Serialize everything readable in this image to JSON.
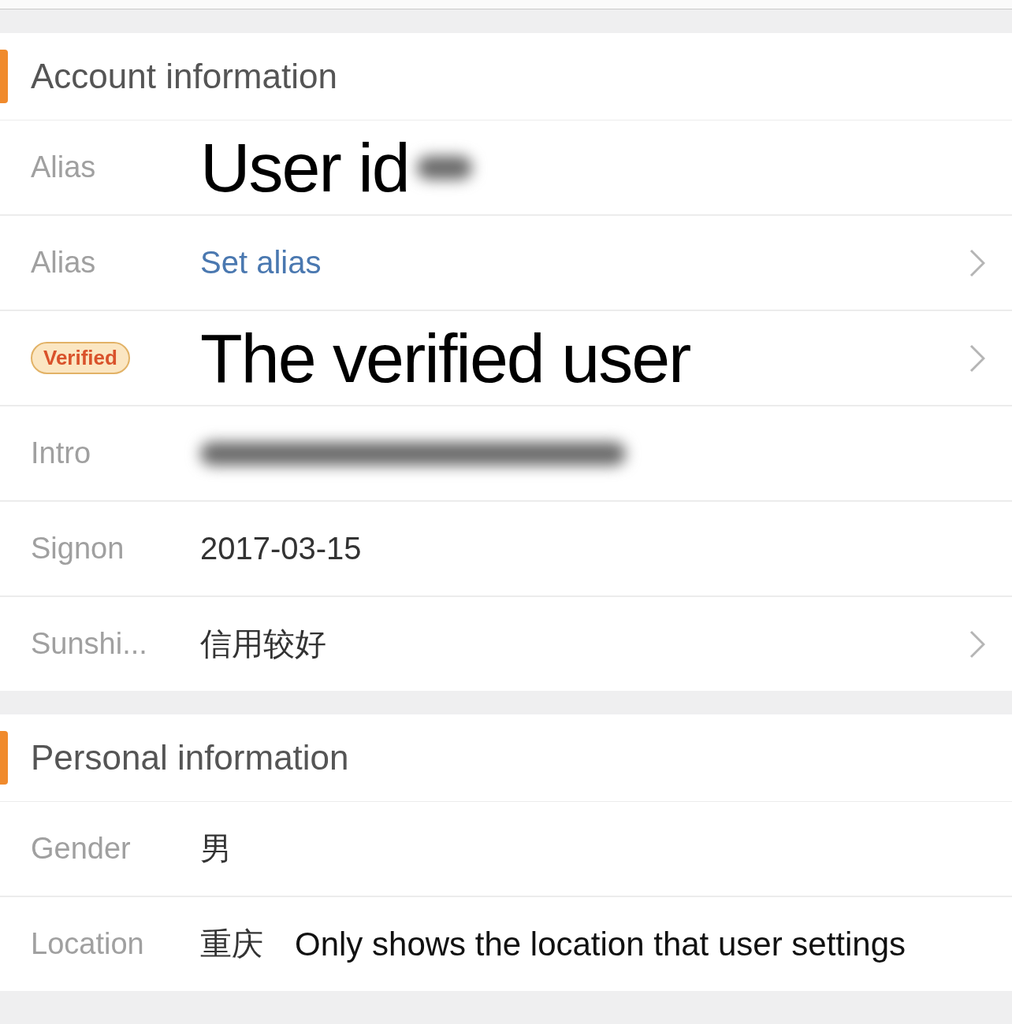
{
  "sections": [
    {
      "title": "Account information",
      "rows": [
        {
          "label": "Alias",
          "kind": "overlay",
          "value": "User id",
          "redacted_tail": true,
          "chevron": false
        },
        {
          "label": "Alias",
          "kind": "link",
          "value": "Set alias",
          "chevron": true
        },
        {
          "badge": "Verified",
          "kind": "overlay",
          "value": "The verified user",
          "redacted_tail": false,
          "chevron": true
        },
        {
          "label": "Intro",
          "kind": "redacted",
          "chevron": false
        },
        {
          "label": "Signon",
          "kind": "plain",
          "value": "2017-03-15",
          "chevron": false
        },
        {
          "label": "Sunshi...",
          "kind": "plain",
          "value": "信用较好",
          "chevron": true
        }
      ]
    },
    {
      "title": "Personal information",
      "rows": [
        {
          "label": "Gender",
          "kind": "plain",
          "value": "男",
          "chevron": false
        },
        {
          "label": "Location",
          "kind": "plain",
          "value": "重庆",
          "note": "Only shows the location that user settings",
          "chevron": false
        }
      ]
    }
  ]
}
